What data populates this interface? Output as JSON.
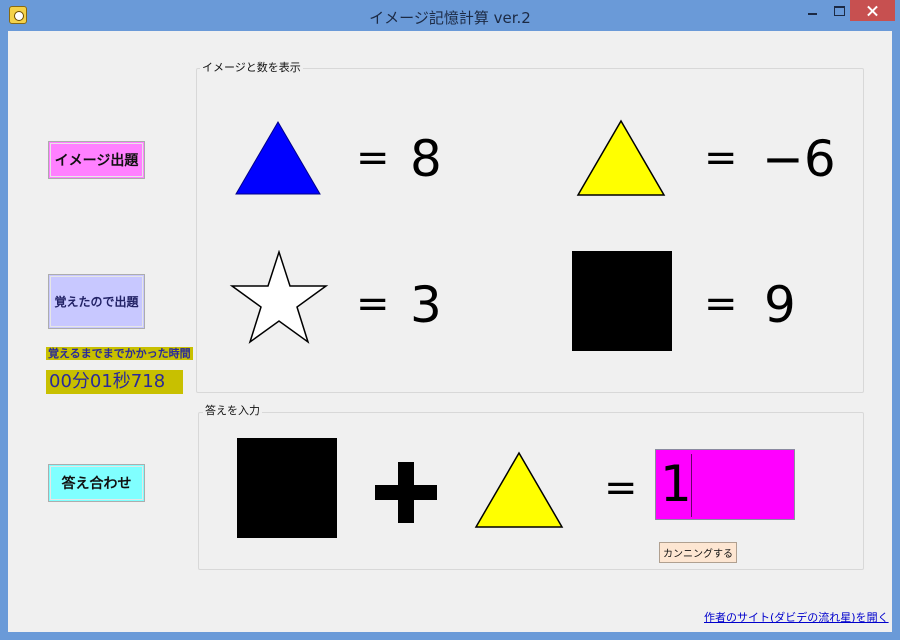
{
  "window": {
    "title": "イメージ記憶計算 ver.2"
  },
  "buttons": {
    "image_quiz": "イメージ出題",
    "memorized_quiz": "覚えたので出題",
    "check_answer": "答え合わせ",
    "cheat": "カンニングする"
  },
  "timer": {
    "label": "覚えるまでまでかかった時間",
    "value": "00分01秒718"
  },
  "display_group": {
    "caption": "イメージと数を表示",
    "items": [
      {
        "icon": "blue-triangle-icon",
        "color": "#0000ff",
        "equals": "=",
        "value": "8"
      },
      {
        "icon": "yellow-triangle-icon",
        "color": "#ffff00",
        "equals": "=",
        "value": "−6"
      },
      {
        "icon": "white-star-icon",
        "color": "#ffffff",
        "equals": "=",
        "value": "3"
      },
      {
        "icon": "black-square-icon",
        "color": "#000000",
        "equals": "=",
        "value": "9"
      }
    ]
  },
  "answer_group": {
    "caption": "答えを入力",
    "operand1_icon": "black-square-icon",
    "operator_icon": "plus-icon",
    "operand2_icon": "yellow-triangle-icon",
    "equals": "=",
    "input_value": "1",
    "input_color": "#ff00ff"
  },
  "footer": {
    "link": "作者のサイト(ダビデの流れ星)を開く"
  }
}
